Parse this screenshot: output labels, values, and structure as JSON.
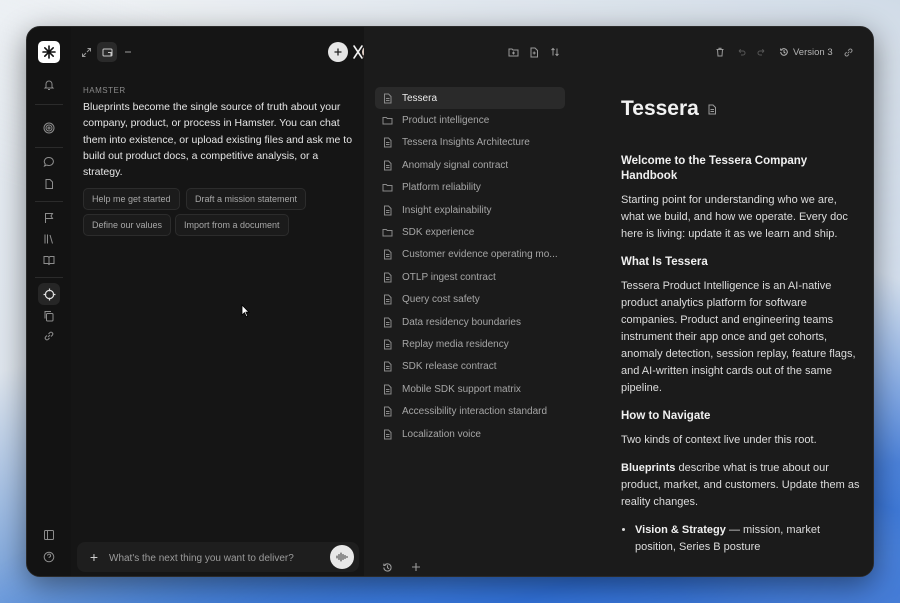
{
  "sidebar_rail": {
    "icons": [
      "logo-icon",
      "bell-icon",
      "target-icon",
      "chat-bubble-icon",
      "page-icon",
      "flag-icon",
      "library-icon",
      "book-icon",
      "crosshair-icon",
      "copy-icon",
      "link-icon",
      "layout-icon",
      "help-icon"
    ]
  },
  "chat": {
    "label": "HAMSTER",
    "intro": "Blueprints become the single source of truth about your company, product, or process in Hamster. You can chat them into existence, or upload existing files and ask me to build out product docs, a competitive analysis, or a strategy.",
    "suggestions": [
      "Help me get started",
      "Draft a mission statement",
      "Define our values",
      "Import from a document"
    ],
    "composer_placeholder": "What's the next thing you want to deliver?"
  },
  "toolbar": {
    "version_label": "Version 3"
  },
  "tree": {
    "items": [
      {
        "label": "Tessera",
        "type": "doc",
        "active": true
      },
      {
        "label": "Product intelligence",
        "type": "folder"
      },
      {
        "label": "Tessera Insights Architecture",
        "type": "doc"
      },
      {
        "label": "Anomaly signal contract",
        "type": "doc"
      },
      {
        "label": "Platform reliability",
        "type": "folder"
      },
      {
        "label": "Insight explainability",
        "type": "doc"
      },
      {
        "label": "SDK experience",
        "type": "folder"
      },
      {
        "label": "Customer evidence operating mo...",
        "type": "doc"
      },
      {
        "label": "OTLP ingest contract",
        "type": "doc"
      },
      {
        "label": "Query cost safety",
        "type": "doc"
      },
      {
        "label": "Data residency boundaries",
        "type": "doc"
      },
      {
        "label": "Replay media residency",
        "type": "doc"
      },
      {
        "label": "SDK release contract",
        "type": "doc"
      },
      {
        "label": "Mobile SDK support matrix",
        "type": "doc"
      },
      {
        "label": "Accessibility interaction standard",
        "type": "doc"
      },
      {
        "label": "Localization voice",
        "type": "doc"
      }
    ]
  },
  "document": {
    "title": "Tessera",
    "welcome_heading": "Welcome to the Tessera Company Handbook",
    "welcome_body": "Starting point for understanding who we are, what we build, and how we operate. Every doc here is living: update it as we learn and ship.",
    "what_heading": "What Is Tessera",
    "what_body": "Tessera Product Intelligence is an AI-native product analytics platform for software companies. Product and engineering teams instrument their app once and get cohorts, anomaly detection, session replay, feature flags, and AI-written insight cards out of the same pipeline.",
    "nav_heading": "How to Navigate",
    "nav_body": "Two kinds of context live under this root.",
    "blueprints_term": "Blueprints",
    "blueprints_body": " describe what is true about our product, market, and customers. Update them as reality changes.",
    "bullet_term": "Vision & Strategy",
    "bullet_body": " — mission, market position, Series B posture"
  }
}
